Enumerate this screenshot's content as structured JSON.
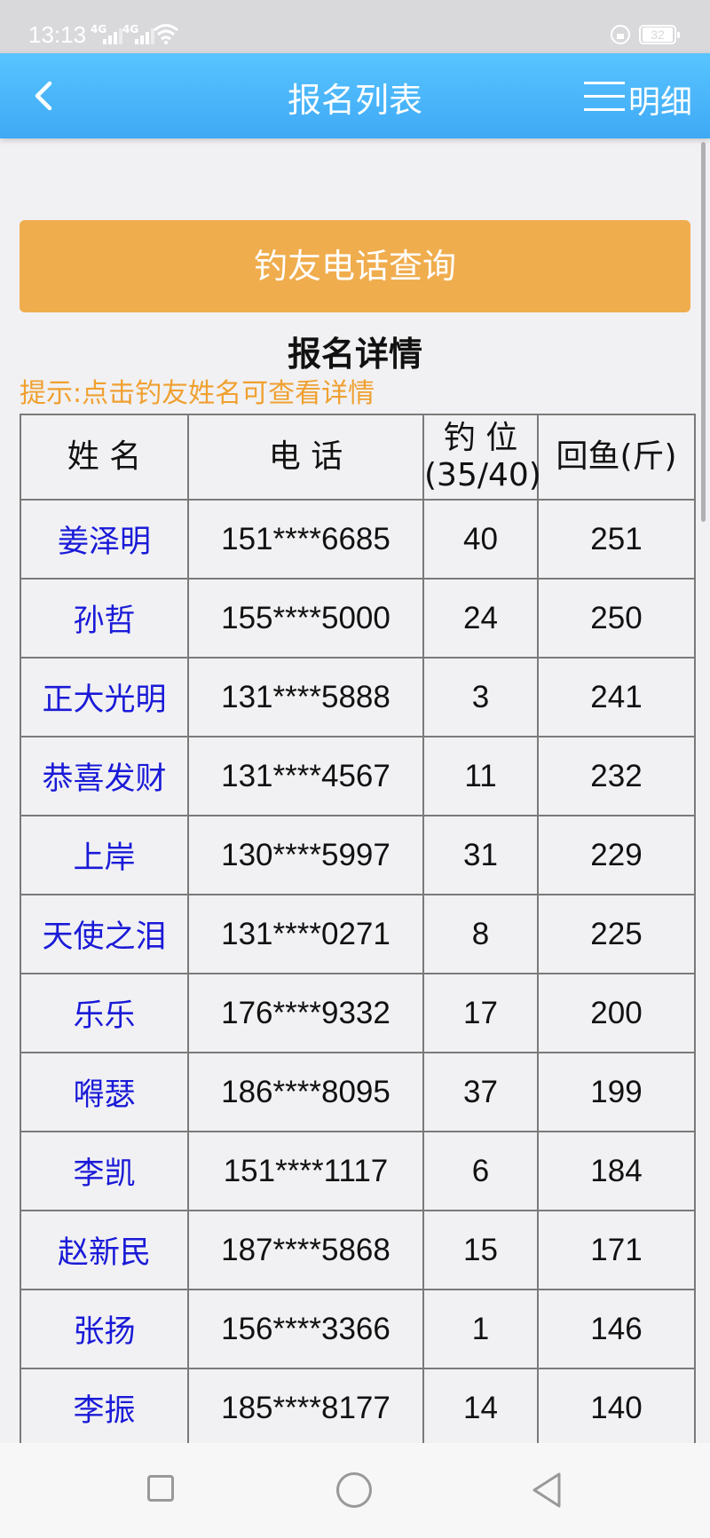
{
  "status_bar": {
    "time": "13:13",
    "signal_1": "4G",
    "signal_2": "4G",
    "battery": "32"
  },
  "header": {
    "title": "报名列表",
    "detail_label": "明细"
  },
  "query_button": "钓友电话查询",
  "section_title": "报名详情",
  "hint": "提示:点击钓友姓名可查看详情",
  "table": {
    "headers": {
      "name": "姓 名",
      "phone": "电 话",
      "spot_line1": "钓 位",
      "spot_line2": "(35/40)",
      "catch": "回鱼(斤)"
    },
    "rows": [
      {
        "name": "姜泽明",
        "phone": "151****6685",
        "spot": "40",
        "catch": "251"
      },
      {
        "name": "孙哲",
        "phone": "155****5000",
        "spot": "24",
        "catch": "250"
      },
      {
        "name": "正大光明",
        "phone": "131****5888",
        "spot": "3",
        "catch": "241"
      },
      {
        "name": "恭喜发财",
        "phone": "131****4567",
        "spot": "11",
        "catch": "232"
      },
      {
        "name": "上岸",
        "phone": "130****5997",
        "spot": "31",
        "catch": "229"
      },
      {
        "name": "天使之泪",
        "phone": "131****0271",
        "spot": "8",
        "catch": "225"
      },
      {
        "name": "乐乐",
        "phone": "176****9332",
        "spot": "17",
        "catch": "200"
      },
      {
        "name": "嘚瑟",
        "phone": "186****8095",
        "spot": "37",
        "catch": "199"
      },
      {
        "name": "李凯",
        "phone": "151****1117",
        "spot": "6",
        "catch": "184"
      },
      {
        "name": "赵新民",
        "phone": "187****5868",
        "spot": "15",
        "catch": "171"
      },
      {
        "name": "张扬",
        "phone": "156****3366",
        "spot": "1",
        "catch": "146"
      },
      {
        "name": "李振",
        "phone": "185****8177",
        "spot": "14",
        "catch": "140"
      }
    ]
  },
  "colors": {
    "header_gradient_top": "#58c4ff",
    "header_gradient_bottom": "#3fa9f5",
    "button_orange": "#f0ad4e",
    "hint_orange": "#f0a030",
    "name_link_blue": "#1a1ad8",
    "background": "#f1f1f3"
  },
  "icons": {
    "back": "chevron-left-icon",
    "menu": "hamburger-icon",
    "nav_recent": "square-icon",
    "nav_home": "circle-icon",
    "nav_back": "triangle-left-icon"
  }
}
